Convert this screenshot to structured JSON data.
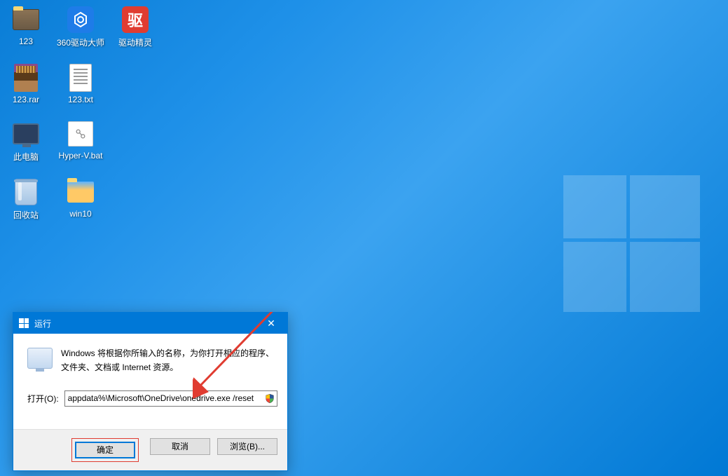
{
  "desktop": {
    "icons": [
      [
        {
          "label": "123",
          "type": "folder-image"
        },
        {
          "label": "360驱动大师",
          "type": "app-blue"
        },
        {
          "label": "驱动精灵",
          "type": "app-red",
          "glyph": "驱"
        }
      ],
      [
        {
          "label": "123.rar",
          "type": "rar"
        },
        {
          "label": "123.txt",
          "type": "txt"
        }
      ],
      [
        {
          "label": "此电脑",
          "type": "pc"
        },
        {
          "label": "Hyper-V.bat",
          "type": "bat"
        }
      ],
      [
        {
          "label": "回收站",
          "type": "bin"
        },
        {
          "label": "win10",
          "type": "folder-blue"
        }
      ]
    ]
  },
  "run_dialog": {
    "title": "运行",
    "description": "Windows 将根据你所输入的名称，为你打开相应的程序、文件夹、文档或 Internet 资源。",
    "open_label": "打开(O):",
    "command_value": "appdata%\\Microsoft\\OneDrive\\onedrive.exe /reset",
    "ok_button": "确定",
    "cancel_button": "取消",
    "browse_button": "浏览(B)...",
    "close_glyph": "✕"
  }
}
